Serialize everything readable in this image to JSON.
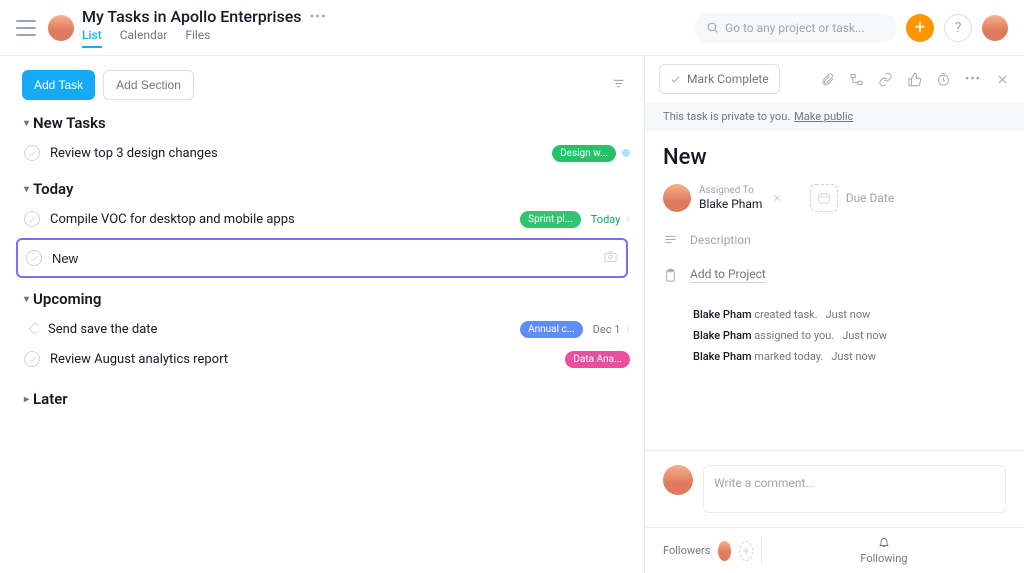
{
  "header": {
    "title": "My Tasks in Apollo Enterprises",
    "tabs": [
      "List",
      "Calendar",
      "Files"
    ],
    "activeTab": 0,
    "searchPlaceholder": "Go to any project or task..."
  },
  "left": {
    "addTask": "Add Task",
    "addSection": "Add Section",
    "sections": {
      "newTasks": {
        "title": "New Tasks",
        "rows": [
          {
            "text": "Review top 3 design changes",
            "pill": "Design w...",
            "pillClass": "green",
            "dot": true
          }
        ]
      },
      "today": {
        "title": "Today",
        "rows": [
          {
            "text": "Compile VOC for desktop and mobile apps",
            "pill": "Sprint pl...",
            "pillClass": "green2",
            "date": "Today",
            "dateClass": "",
            "chevron": true
          },
          {
            "editing": true,
            "text": "New"
          }
        ]
      },
      "upcoming": {
        "title": "Upcoming",
        "rows": [
          {
            "icon": "milestone",
            "text": "Send save the date",
            "pill": "Annual c...",
            "pillClass": "blue",
            "date": "Dec 1",
            "dateClass": "gray",
            "chevron": true
          },
          {
            "text": "Review August analytics report",
            "pill": "Data Ana...",
            "pillClass": "pink"
          }
        ]
      },
      "later": {
        "title": "Later"
      }
    }
  },
  "right": {
    "markComplete": "Mark Complete",
    "privacy": "This task is private to you.",
    "makePublic": "Make public",
    "taskTitle": "New",
    "assignedToLabel": "Assigned To",
    "assignee": "Blake Pham",
    "dueDateLabel": "Due Date",
    "descriptionLabel": "Description",
    "addToProject": "Add to Project",
    "activity": [
      {
        "actor": "Blake Pham",
        "action": " created task.",
        "ts": "Just now"
      },
      {
        "actor": "Blake Pham",
        "action": " assigned to you.",
        "ts": "Just now"
      },
      {
        "actor": "Blake Pham",
        "action": " marked today.",
        "ts": "Just now"
      }
    ],
    "commentPlaceholder": "Write a comment...",
    "followersLabel": "Followers",
    "followingLabel": "Following"
  }
}
